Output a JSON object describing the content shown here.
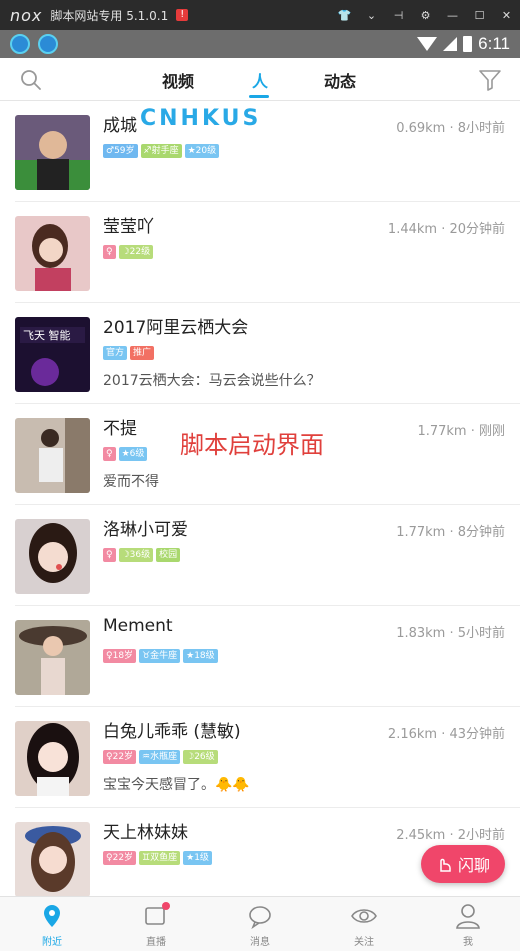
{
  "emulator": {
    "logo": "nox",
    "title": "脚本网站专用 5.1.0.1",
    "warning": "!"
  },
  "status_bar": {
    "time": "6:11"
  },
  "top_nav": {
    "tabs": [
      "视频",
      "人",
      "动态"
    ],
    "active_tab": "人",
    "accent_color": "#1aa7e6"
  },
  "overlays": {
    "brand": "CNHKUS",
    "script_text": "脚本启动界面"
  },
  "users": [
    {
      "name": "成城",
      "meta": "0.69km · 8小时前",
      "badges": [
        {
          "text": "♂59岁",
          "color": "blue"
        },
        {
          "text": "♐射手座",
          "color": "green"
        },
        {
          "text": "★20级",
          "color": "sky"
        }
      ],
      "sign": ""
    },
    {
      "name": "莹莹吖",
      "meta": "1.44km · 20分钟前",
      "badges": [
        {
          "text": "♀",
          "color": "pink"
        },
        {
          "text": "☽22级",
          "color": "lime"
        }
      ],
      "sign": ""
    },
    {
      "name": "2017阿里云栖大会",
      "meta": "",
      "badges": [
        {
          "text": "官方",
          "color": "sky"
        },
        {
          "text": "推广",
          "color": "red"
        }
      ],
      "sign": "2017云栖大会：马云会说些什么？"
    },
    {
      "name": "不提",
      "meta": "1.77km · 刚刚",
      "badges": [
        {
          "text": "♀",
          "color": "pink"
        },
        {
          "text": "★6级",
          "color": "sky"
        }
      ],
      "sign": "爱而不得"
    },
    {
      "name": "洛琳小可爱",
      "meta": "1.77km · 8分钟前",
      "badges": [
        {
          "text": "♀",
          "color": "pink"
        },
        {
          "text": "☽36级",
          "color": "lime"
        },
        {
          "text": "校园",
          "color": "green"
        }
      ],
      "sign": ""
    },
    {
      "name": "Mement",
      "meta": "1.83km · 5小时前",
      "badges": [
        {
          "text": "♀18岁",
          "color": "pink"
        },
        {
          "text": "♉金牛座",
          "color": "sky"
        },
        {
          "text": "★18级",
          "color": "sky"
        }
      ],
      "sign": ""
    },
    {
      "name": "白兔儿乖乖 (慧敏)",
      "meta": "2.16km · 43分钟前",
      "badges": [
        {
          "text": "♀22岁",
          "color": "pink"
        },
        {
          "text": "♒水瓶座",
          "color": "sky"
        },
        {
          "text": "☽26级",
          "color": "lime"
        }
      ],
      "sign": "宝宝今天感冒了。🐥🐥"
    },
    {
      "name": "天上林妹妹",
      "meta": "2.45km · 2小时前",
      "badges": [
        {
          "text": "♀22岁",
          "color": "pink"
        },
        {
          "text": "♊双鱼座",
          "color": "lime"
        },
        {
          "text": "★1级",
          "color": "sky"
        }
      ],
      "sign": ""
    }
  ],
  "flash_chat": {
    "label": "闪聊",
    "color": "#f0466a"
  },
  "bottom_nav": [
    {
      "label": "附近",
      "icon": "location-pin-icon",
      "active": true
    },
    {
      "label": "直播",
      "icon": "video-camera-icon",
      "active": false
    },
    {
      "label": "消息",
      "icon": "chat-bubble-icon",
      "active": false
    },
    {
      "label": "关注",
      "icon": "eye-icon",
      "active": false
    },
    {
      "label": "我",
      "icon": "person-icon",
      "active": false
    }
  ]
}
